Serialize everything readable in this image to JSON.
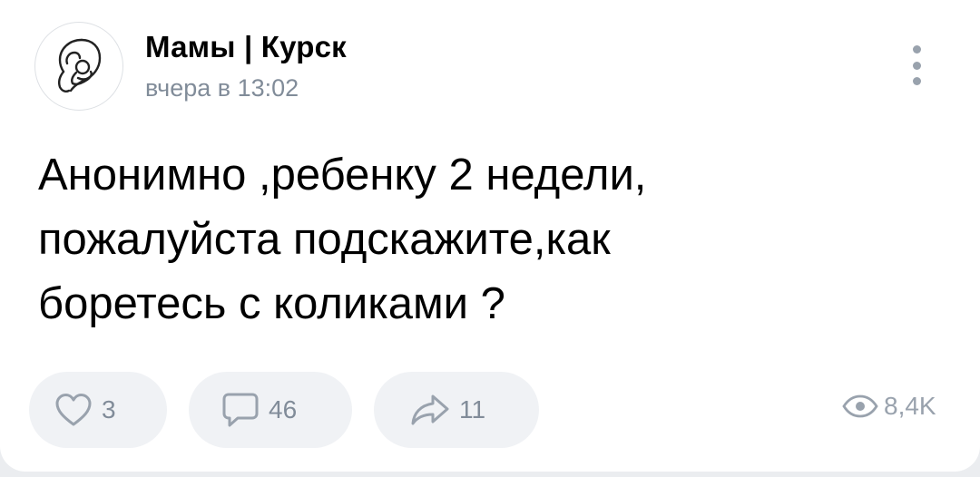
{
  "post": {
    "group_name": "Мамы | Курск",
    "timestamp": "вчера в 13:02",
    "text": "Анонимно ,ребенку 2 недели,\nпожалуйста подскажите,как\nборетесь с коликами ?"
  },
  "actions": {
    "likes": "3",
    "comments": "46",
    "shares": "11",
    "views": "8,4K"
  },
  "icons": {
    "avatar": "mother-and-baby-logo",
    "menu": "more-vertical-icon",
    "like": "heart-icon",
    "comment": "comment-icon",
    "share": "share-arrow-icon",
    "views": "eye-icon"
  },
  "colors": {
    "card_bg": "#ffffff",
    "page_bg": "#ebedf0",
    "secondary_text": "#818c99",
    "pill_bg": "#f0f2f5"
  }
}
